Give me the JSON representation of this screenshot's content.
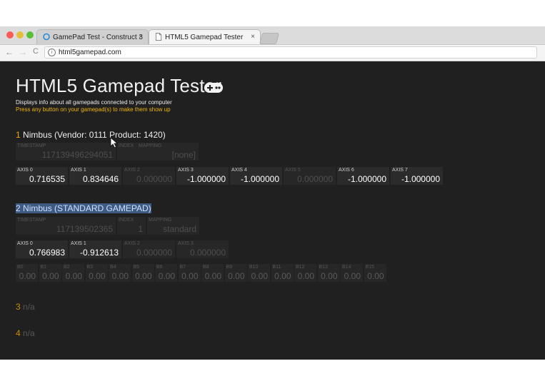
{
  "browser": {
    "tabs": [
      {
        "title": "GamePad Test - Construct 3",
        "close": "×"
      },
      {
        "title": "HTML5 Gamepad Tester",
        "close": "×"
      }
    ],
    "nav": {
      "back": "←",
      "forward": "→",
      "reload": "C"
    },
    "address": {
      "info": "i",
      "url": "html5gamepad.com"
    }
  },
  "page": {
    "title": "HTML5 Gamepad Tester",
    "subtitle": "Displays info about all gamepads connected to your computer",
    "prompt": "Press any button on your gamepad(s) to make them show up",
    "gamepads": [
      {
        "index": "1",
        "name": "Nimbus (Vendor: 0111 Product: 1420)",
        "timestamp_label": "TIMESTAMP",
        "timestamp": "117139496294051",
        "index_label": "INDEX",
        "index_value": "0",
        "mapping_label": "MAPPING",
        "mapping": "[none]",
        "axes": [
          {
            "label": "AXIS 0",
            "value": "0.716535"
          },
          {
            "label": "AXIS 1",
            "value": "0.834646"
          },
          {
            "label": "AXIS 2",
            "value": "0.000000"
          },
          {
            "label": "AXIS 3",
            "value": "-1.000000"
          },
          {
            "label": "AXIS 4",
            "value": "-1.000000"
          },
          {
            "label": "AXIS 5",
            "value": "0.000000"
          },
          {
            "label": "AXIS 6",
            "value": "-1.000000"
          },
          {
            "label": "AXIS 7",
            "value": "-1.000000"
          }
        ]
      },
      {
        "index": "2",
        "name": "Nimbus (STANDARD GAMEPAD)",
        "timestamp_label": "TIMESTAMP",
        "timestamp": "117139502365",
        "index_label": "INDEX",
        "index_value": "1",
        "mapping_label": "MAPPING",
        "mapping": "standard",
        "axes": [
          {
            "label": "AXIS 0",
            "value": "0.766983"
          },
          {
            "label": "AXIS 1",
            "value": "-0.912613"
          },
          {
            "label": "AXIS 2",
            "value": "0.000000"
          },
          {
            "label": "AXIS 3",
            "value": "0.000000"
          }
        ],
        "buttons": [
          {
            "label": "B0",
            "value": "0.00"
          },
          {
            "label": "B1",
            "value": "0.00"
          },
          {
            "label": "B2",
            "value": "0.00"
          },
          {
            "label": "B3",
            "value": "0.00"
          },
          {
            "label": "B4",
            "value": "0.00"
          },
          {
            "label": "B5",
            "value": "0.00"
          },
          {
            "label": "B6",
            "value": "0.00"
          },
          {
            "label": "B7",
            "value": "0.00"
          },
          {
            "label": "B8",
            "value": "0.00"
          },
          {
            "label": "B9",
            "value": "0.00"
          },
          {
            "label": "B10",
            "value": "0.00"
          },
          {
            "label": "B11",
            "value": "0.00"
          },
          {
            "label": "B12",
            "value": "0.00"
          },
          {
            "label": "B13",
            "value": "0.00"
          },
          {
            "label": "B14",
            "value": "0.00"
          },
          {
            "label": "B15",
            "value": "0.00"
          }
        ]
      },
      {
        "index": "3",
        "name": "n/a"
      },
      {
        "index": "4",
        "name": "n/a"
      }
    ]
  },
  "colors": {
    "accent": "#f0a800",
    "background": "#202020",
    "selection": "#3e5a82"
  }
}
